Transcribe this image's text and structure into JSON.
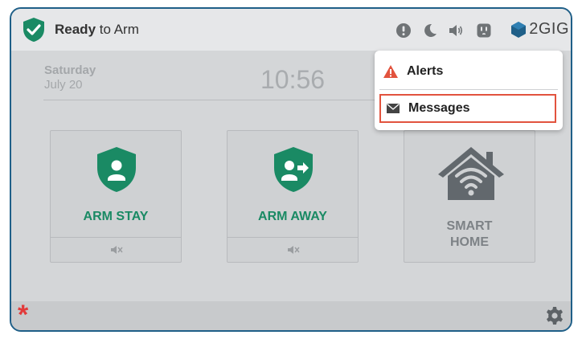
{
  "status": {
    "state_bold": "Ready",
    "state_rest": " to Arm",
    "colors": {
      "shield": "#1a8a64",
      "accent_red": "#e23b3b"
    }
  },
  "header_icons": [
    "alert-circle-icon",
    "moon-icon",
    "speaker-icon",
    "outlet-icon"
  ],
  "brand": {
    "name": "2GIG"
  },
  "date": {
    "day": "Saturday",
    "date": "July 20"
  },
  "clock": {
    "time": "10:56"
  },
  "tiles": [
    {
      "label": "ARM STAY",
      "icon": "shield-person-icon",
      "footer_icon": "mute-icon"
    },
    {
      "label": "ARM AWAY",
      "icon": "shield-person-arrow-icon",
      "footer_icon": "mute-icon"
    },
    {
      "label_line1": "SMART",
      "label_line2": "HOME",
      "icon": "smart-home-wifi-icon"
    }
  ],
  "menu": {
    "items": [
      {
        "label": "Alerts",
        "icon": "warning-triangle-icon"
      },
      {
        "label": "Messages",
        "icon": "envelope-icon",
        "highlighted": true
      }
    ]
  },
  "bottom": {
    "emergency_icon": "asterisk-icon",
    "settings_icon": "gear-icon",
    "emergency_symbol": "*"
  }
}
